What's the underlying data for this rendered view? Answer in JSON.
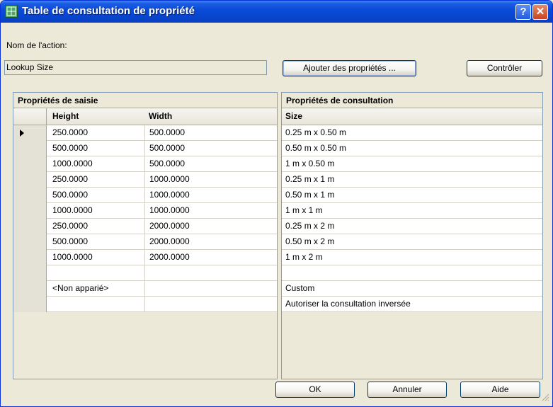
{
  "window": {
    "title": "Table de consultation de propriété",
    "help_label": "?",
    "close_label": "✕"
  },
  "action": {
    "label": "Nom de l'action:",
    "value": "Lookup Size"
  },
  "buttons": {
    "add_props": "Ajouter des propriétés ...",
    "check": "Contrôler",
    "ok": "OK",
    "cancel": "Annuler",
    "help": "Aide"
  },
  "input_grid": {
    "title": "Propriétés de saisie",
    "columns": [
      "Height",
      "Width"
    ],
    "rows": [
      [
        "250.0000",
        "500.0000"
      ],
      [
        "500.0000",
        "500.0000"
      ],
      [
        "1000.0000",
        "500.0000"
      ],
      [
        "250.0000",
        "1000.0000"
      ],
      [
        "500.0000",
        "1000.0000"
      ],
      [
        "1000.0000",
        "1000.0000"
      ],
      [
        "250.0000",
        "2000.0000"
      ],
      [
        "500.0000",
        "2000.0000"
      ],
      [
        "1000.0000",
        "2000.0000"
      ],
      [
        "",
        ""
      ],
      [
        "<Non apparié>",
        ""
      ],
      [
        "",
        ""
      ]
    ]
  },
  "lookup_grid": {
    "title": "Propriétés de consultation",
    "columns": [
      "Size"
    ],
    "rows": [
      "0.25 m x 0.50 m",
      "0.50 m x 0.50 m",
      "1 m x 0.50 m",
      "0.25 m x 1 m",
      "0.50 m x 1 m",
      "1 m x 1 m",
      "0.25 m x 2 m",
      "0.50 m x 2 m",
      "1 m x 2 m",
      "",
      "Custom",
      "Autoriser la consultation inversée"
    ]
  },
  "icons": {
    "app": "block-table-icon",
    "help": "help-icon",
    "close": "close-icon",
    "row_pointer": "row-pointer-icon",
    "grip": "size-grip-icon"
  }
}
